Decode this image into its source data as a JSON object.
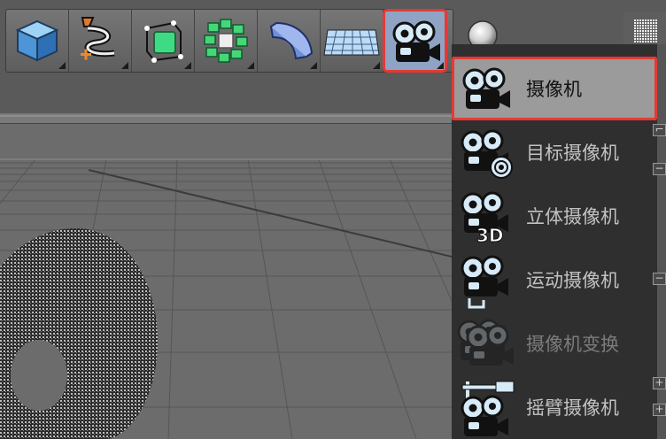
{
  "toolbar": {
    "tools": [
      {
        "id": "cube",
        "icon": "cube-icon"
      },
      {
        "id": "spline",
        "icon": "spline-pen-icon"
      },
      {
        "id": "generator",
        "icon": "generator-cube-icon"
      },
      {
        "id": "mograph",
        "icon": "cloner-icon"
      },
      {
        "id": "deformer",
        "icon": "bend-deformer-icon"
      },
      {
        "id": "floor",
        "icon": "floor-icon"
      },
      {
        "id": "camera",
        "icon": "camera-icon",
        "active": true
      }
    ],
    "accent": "#e53935"
  },
  "camera_menu": {
    "items": [
      {
        "label": "摄像机",
        "icon": "camera-icon",
        "selected": true
      },
      {
        "label": "目标摄像机",
        "icon": "target-camera-icon"
      },
      {
        "label": "立体摄像机",
        "icon": "stereo-camera-icon",
        "badge": "3D"
      },
      {
        "label": "运动摄像机",
        "icon": "motion-camera-icon"
      },
      {
        "label": "摄像机变换",
        "icon": "camera-morph-icon",
        "disabled": true
      },
      {
        "label": "摇臂摄像机",
        "icon": "crane-camera-icon"
      }
    ]
  }
}
